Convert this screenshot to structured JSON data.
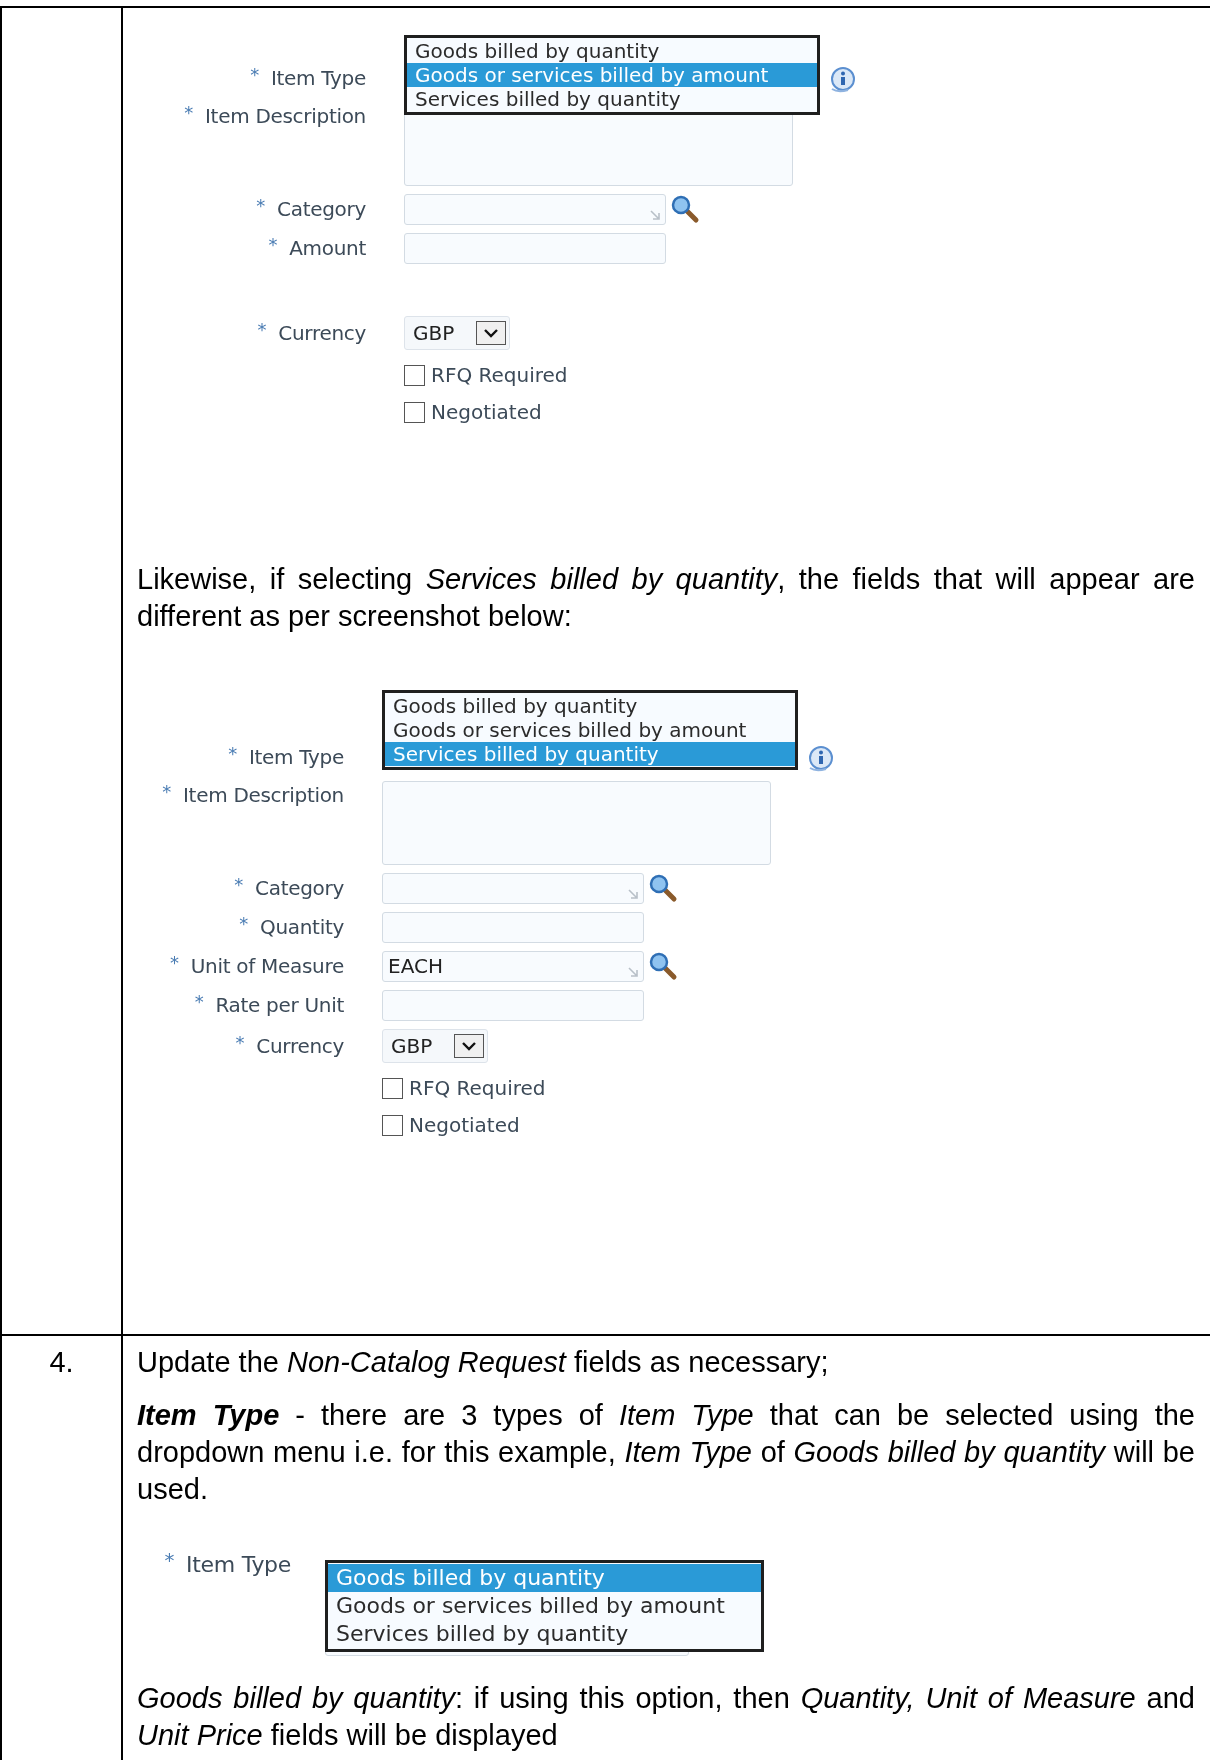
{
  "table": {
    "rows": [
      {
        "number": "",
        "blocks": [
          {
            "kind": "form",
            "info_icon": true,
            "fields": [
              {
                "kind": "listbox",
                "mark": "*",
                "label": "Item Type",
                "options": [
                  {
                    "label": "Goods billed by quantity",
                    "selected": false
                  },
                  {
                    "label": "Goods or services billed by amount",
                    "selected": true
                  },
                  {
                    "label": "Services billed by quantity",
                    "selected": false
                  }
                ]
              },
              {
                "kind": "textarea",
                "mark": "*",
                "label": "Item Description"
              },
              {
                "kind": "lookup",
                "mark": "*",
                "label": "Category"
              },
              {
                "kind": "text",
                "mark": "*",
                "label": "Amount"
              },
              {
                "kind": "spacer"
              },
              {
                "kind": "select",
                "mark": "*",
                "label": "Currency",
                "value": "GBP"
              },
              {
                "kind": "checkbox",
                "label": "RFQ Required",
                "checked": false
              },
              {
                "kind": "checkbox",
                "label": "Negotiated",
                "checked": false
              }
            ]
          },
          {
            "kind": "paragraph",
            "text": "Likewise, if selecting *Services billed by quantity*, the fields that will appear are different as per screenshot below:"
          },
          {
            "kind": "form",
            "info_icon": true,
            "fields": [
              {
                "kind": "listbox",
                "mark": "*",
                "label": "Item Type",
                "options": [
                  {
                    "label": "Goods billed by quantity",
                    "selected": false
                  },
                  {
                    "label": "Goods or services billed by amount",
                    "selected": false
                  },
                  {
                    "label": "Services billed by quantity",
                    "selected": true
                  }
                ]
              },
              {
                "kind": "textarea",
                "mark": "*",
                "label": "Item Description"
              },
              {
                "kind": "lookup",
                "mark": "*",
                "label": "Category"
              },
              {
                "kind": "text",
                "mark": "*",
                "label": "Quantity"
              },
              {
                "kind": "lookup",
                "mark": "*",
                "label": "Unit of Measure",
                "value": "EACH"
              },
              {
                "kind": "text",
                "mark": "*",
                "label": "Rate per Unit"
              },
              {
                "kind": "select",
                "mark": "*",
                "label": "Currency",
                "value": "GBP"
              },
              {
                "kind": "checkbox",
                "label": "RFQ Required",
                "checked": false
              },
              {
                "kind": "checkbox",
                "label": "Negotiated",
                "checked": false
              }
            ]
          }
        ]
      },
      {
        "number": "4.",
        "blocks": [
          {
            "kind": "paragraph",
            "text": "Update the *Non-Catalog Request* fields as necessary;"
          },
          {
            "kind": "paragraph",
            "lead": "Item Type",
            "text": " - there are 3 types of *Item Type* that can be selected using the dropdown menu i.e. for this example, *Item Type* of *Goods billed by quantity* will be used."
          },
          {
            "kind": "form",
            "info_icon": false,
            "fields": [
              {
                "kind": "listbox",
                "mark": "*",
                "label": "Item Type",
                "options": [
                  {
                    "label": "Goods billed by quantity",
                    "selected": true
                  },
                  {
                    "label": "Goods or services billed by amount",
                    "selected": false
                  },
                  {
                    "label": "Services billed by quantity",
                    "selected": false
                  }
                ]
              },
              {
                "kind": "textarea"
              }
            ]
          },
          {
            "kind": "paragraph",
            "text": "*Goods billed by quantity*: if using this option, then *Quantity, Unit of Measure* and *Unit Price* fields will be displayed"
          }
        ]
      }
    ]
  }
}
